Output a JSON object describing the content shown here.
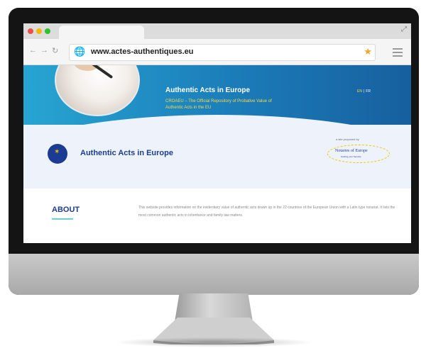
{
  "browser": {
    "url": "www.actes-authentiques.eu",
    "nav_back": "←",
    "nav_forward": "→",
    "nav_reload": "↻",
    "globe": "🌐",
    "star": "★",
    "expand": "⤢"
  },
  "hero": {
    "title": "Authentic Acts in Europe",
    "subtitle": "CROAEU – The Official Repository of Probative Value of Authentic Acts in the EU",
    "lang_en": "EN",
    "lang_fr": "FR"
  },
  "header": {
    "site_name": "Authentic Acts in Europe",
    "publisher_label": "a site proposed by",
    "partner_logo": "Notaries of Europe",
    "partner_tagline": "Guiding your Security"
  },
  "about": {
    "heading": "ABOUT",
    "text": "This website provides information on the evidentiary value of authentic acts drawn up in the 22 countries of the European Union with a Latin type notariat. It lists the most common authentic acts in inheritance and family law matters."
  },
  "colors": {
    "hero_gradient_start": "#27a5d2",
    "hero_gradient_end": "#175f9f",
    "brand_blue": "#1c3c93",
    "subtitle_yellow": "#f7d94c",
    "accent_teal": "#6ccfd0"
  },
  "icons": [
    "globe-icon",
    "star-icon",
    "hamburger-menu-icon",
    "eu-flag-icon",
    "back-arrow-icon",
    "forward-arrow-icon",
    "reload-icon",
    "expand-icon"
  ]
}
